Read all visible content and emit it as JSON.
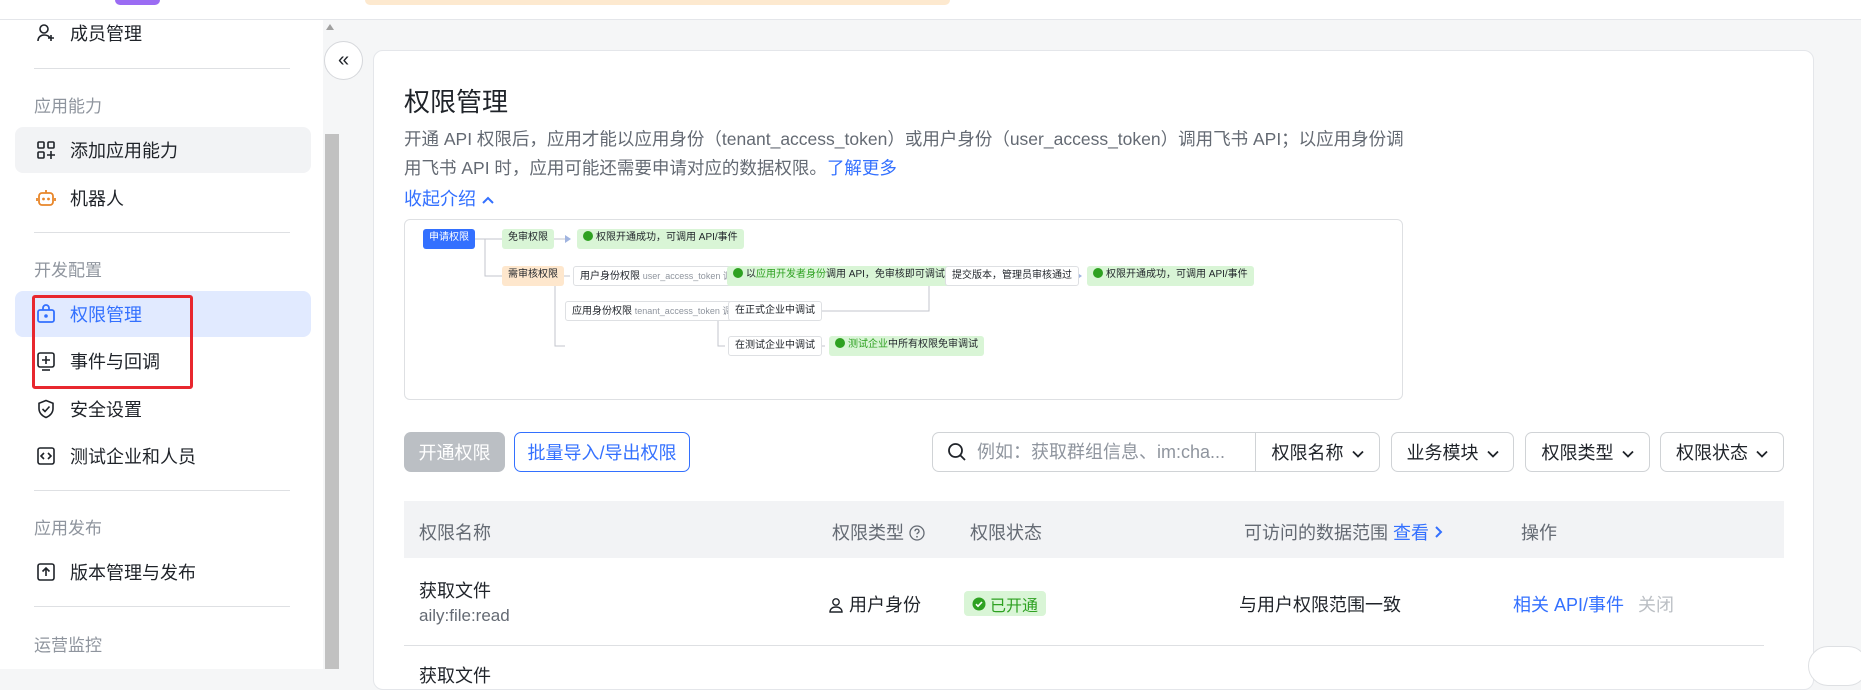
{
  "sidebar": {
    "items": [
      {
        "label": "成员管理",
        "icon": "member-add-icon"
      },
      {
        "label": "添加应用能力",
        "icon": "add-capability-icon"
      },
      {
        "label": "机器人",
        "icon": "robot-icon"
      },
      {
        "label": "权限管理",
        "icon": "permission-icon"
      },
      {
        "label": "事件与回调",
        "icon": "event-icon"
      },
      {
        "label": "安全设置",
        "icon": "shield-icon"
      },
      {
        "label": "测试企业和人员",
        "icon": "test-enterprise-icon"
      },
      {
        "label": "版本管理与发布",
        "icon": "upload-icon"
      }
    ],
    "groups": {
      "capability": "应用能力",
      "dev_config": "开发配置",
      "release": "应用发布",
      "monitor": "运营监控"
    },
    "collapse_icon": "«"
  },
  "page": {
    "title": "权限管理",
    "desc_1": "开通 API 权限后，应用才能以应用身份（tenant_access_token）或用户身份（user_access_token）调用飞书 API；以应用身份调",
    "desc_2": "用飞书 API 时，应用可能还需要申请对应的数据权限。",
    "learn_more": "了解更多",
    "collapse_intro": "收起介绍"
  },
  "flow": {
    "apply": "申请权限",
    "free_review": "免审权限",
    "success_1": "权限开通成功，可调用 API/事件",
    "need_review": "需审核权限",
    "user_identity": "用户身份权限",
    "user_identity_sub": "user_access_token 调用",
    "dev_identity_pre": "以",
    "dev_identity_hl": "应用开发者身份",
    "dev_identity_post": "调用 API，免审核即可调试",
    "submit": "提交版本，管理员审核通过",
    "success_2": "权限开通成功，可调用 API/事件",
    "app_identity": "应用身份权限",
    "app_identity_sub": "tenant_access_token 调用",
    "formal_debug": "在正式企业中调试",
    "test_debug": "在测试企业中调试",
    "test_free_hl": "测试企业",
    "test_free_post": "中所有权限免审调试"
  },
  "toolbar": {
    "open_label": "开通权限",
    "batch_label": "批量导入/导出权限",
    "search_placeholder": "例如：获取群组信息、im:cha...",
    "filters": [
      "权限名称",
      "业务模块",
      "权限类型",
      "权限状态"
    ]
  },
  "table": {
    "headers": {
      "name": "权限名称",
      "type": "权限类型",
      "status": "权限状态",
      "scope": "可访问的数据范围",
      "scope_link": "查看",
      "action": "操作"
    },
    "rows": [
      {
        "name": "获取文件",
        "scope_code": "aily:file:read",
        "type": "用户身份",
        "status": "已开通",
        "data_scope": "与用户权限范围一致",
        "action_api": "相关 API/事件",
        "action_close": "关闭"
      },
      {
        "name": "获取文件"
      }
    ]
  },
  "colors": {
    "accent": "#3370ff",
    "active_bg": "#e1eaff",
    "success": "#2ea121",
    "annotation_red": "#e8272f"
  }
}
